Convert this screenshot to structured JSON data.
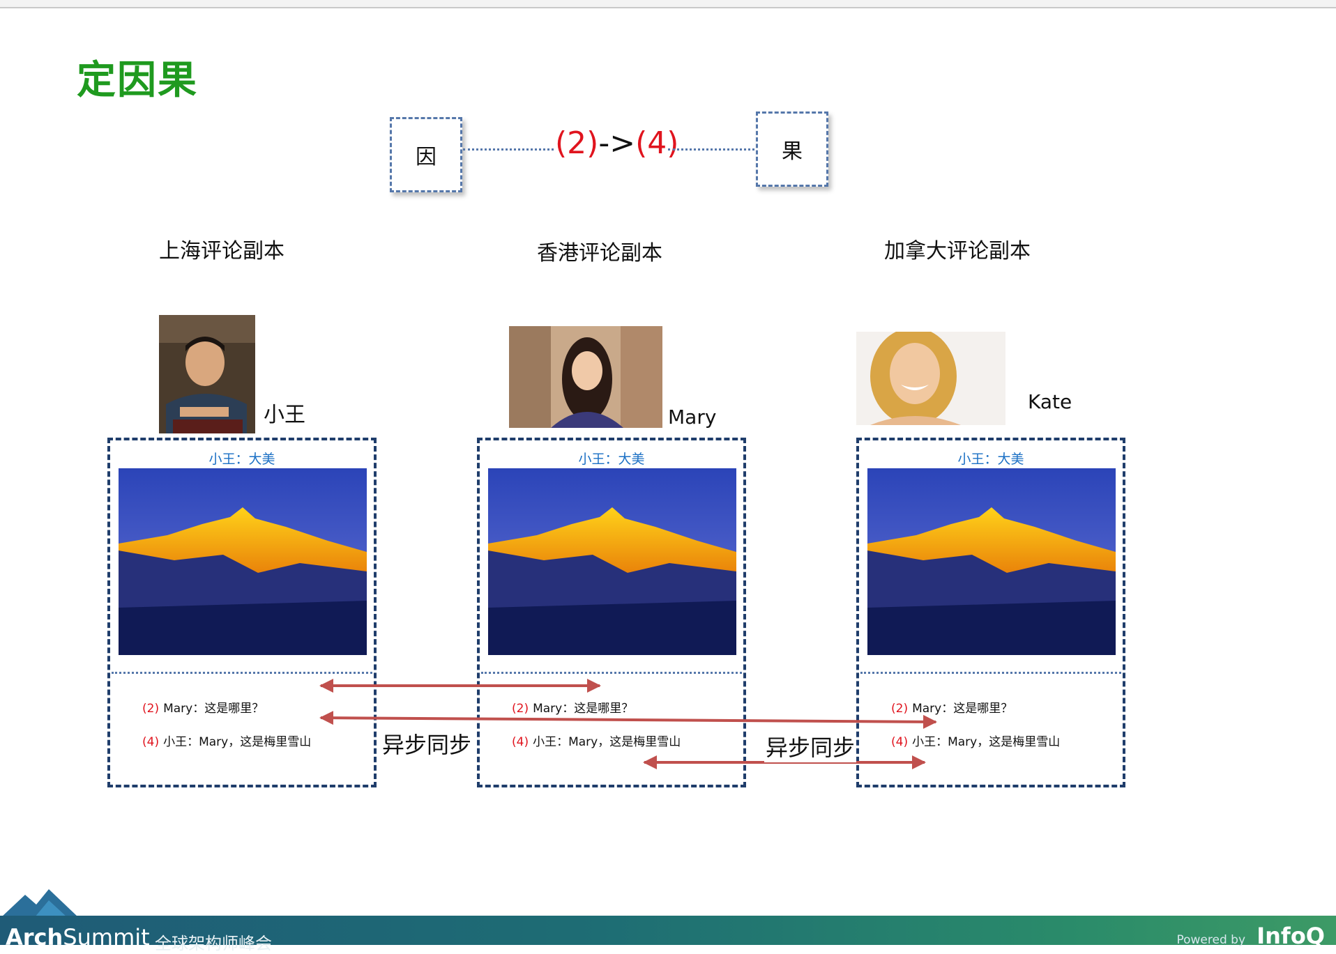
{
  "slide": {
    "title": "定因果"
  },
  "causality": {
    "cause_label": "因",
    "effect_label": "果",
    "order_cause": "(2)",
    "order_arrow": "->",
    "order_effect": "(4)"
  },
  "replicas": [
    {
      "title": "上海评论副本",
      "user": "小王",
      "caption": "小王：大美",
      "comments": [
        {
          "num": "(2)",
          "text": "Mary：这是哪里？"
        },
        {
          "num": "(4)",
          "text": "小王：Mary，这是梅里雪山"
        }
      ]
    },
    {
      "title": "香港评论副本",
      "user": "Mary",
      "caption": "小王：大美",
      "comments": [
        {
          "num": "(2)",
          "text": "Mary：这是哪里？"
        },
        {
          "num": "(4)",
          "text": "小王：Mary，这是梅里雪山"
        }
      ]
    },
    {
      "title": "加拿大评论副本",
      "user": "Kate",
      "caption": "小王：大美",
      "comments": [
        {
          "num": "(2)",
          "text": "Mary：这是哪里？"
        },
        {
          "num": "(4)",
          "text": "小王：Mary，这是梅里雪山"
        }
      ]
    }
  ],
  "sync": {
    "label_left": "异步同步",
    "label_right": "异步同步"
  },
  "footer": {
    "brand_bold": "Arch",
    "brand_light": "Summit",
    "brand_sub": "全球架构师峰会",
    "powered_by": "Powered by",
    "infoq": "InfoQ"
  },
  "colors": {
    "title_green": "#1f9a1f",
    "order_red": "#e0141e",
    "frame_navy": "#1f3d6b",
    "arrow_red": "#c0504d",
    "caption_blue": "#1a6fc4"
  }
}
